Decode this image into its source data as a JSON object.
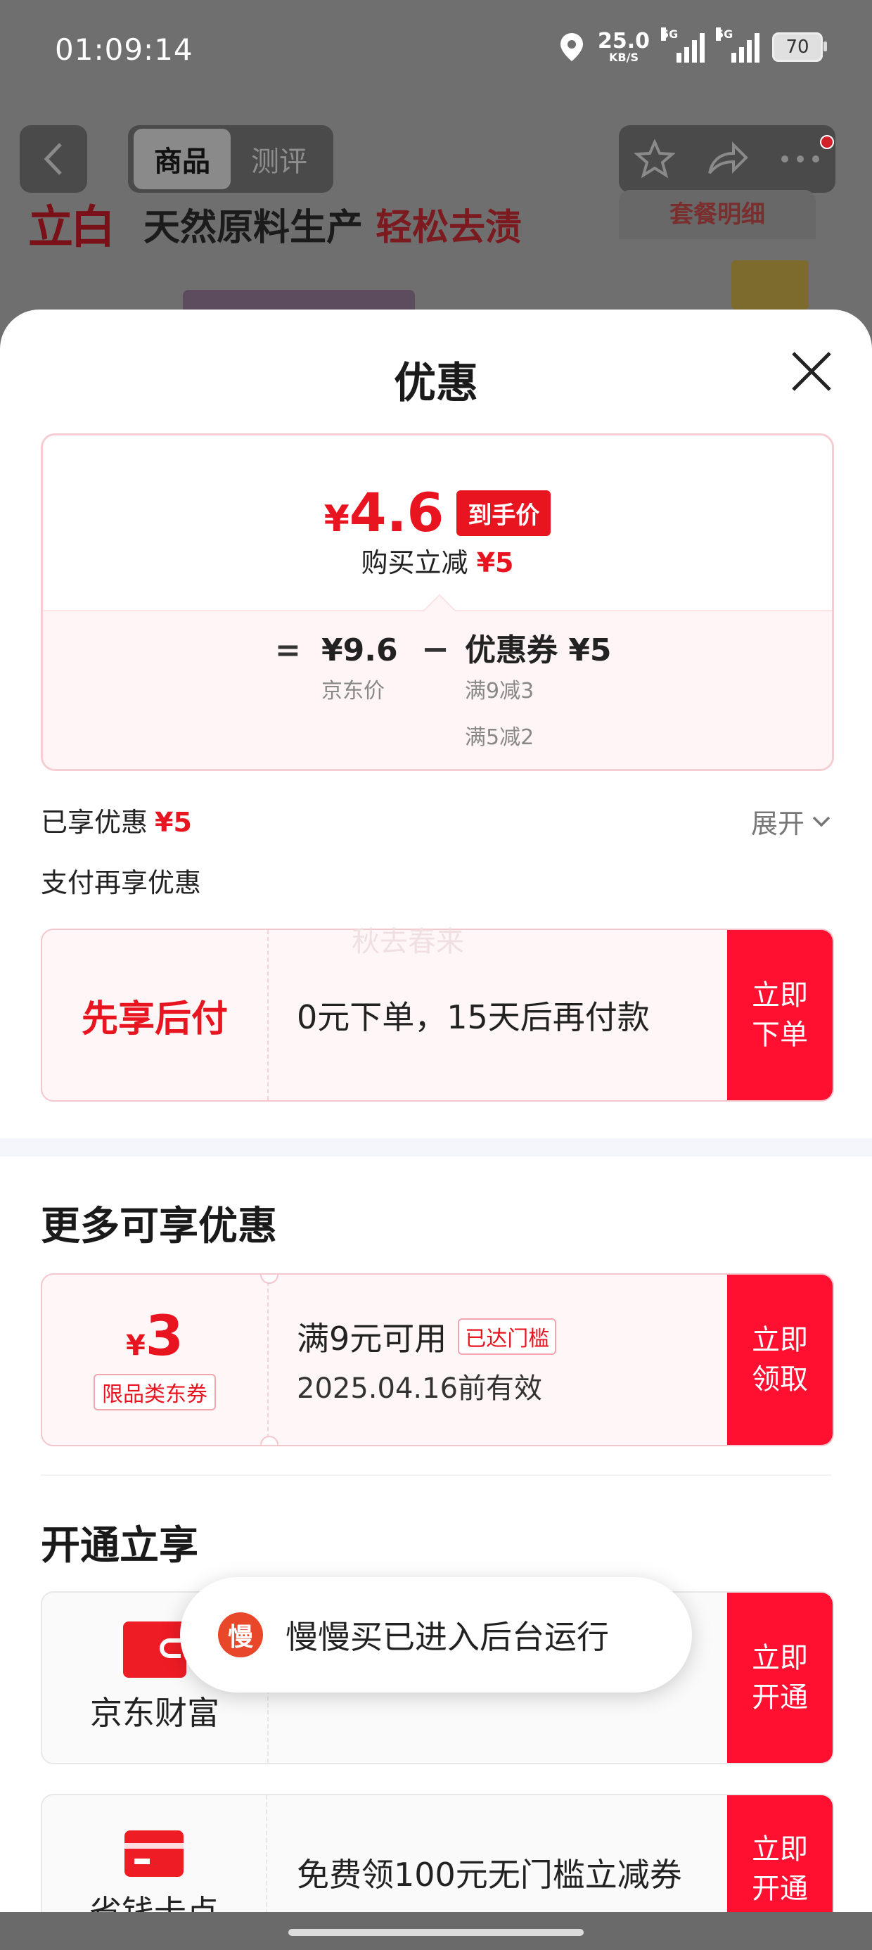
{
  "status_bar": {
    "time": "01:09:14",
    "net_speed": "25.0",
    "net_unit": "KB/S",
    "sig1": "5G",
    "sig2": "5G",
    "battery": "70"
  },
  "nav": {
    "tab_goods": "商品",
    "tab_review": "测评"
  },
  "bg": {
    "brand": "立白",
    "slogan_black": "天然原料生产",
    "slogan_red": "轻松去渍",
    "package_label": "套餐明细"
  },
  "sheet": {
    "title": "优惠",
    "price": {
      "symbol": "¥",
      "final": "4.6",
      "tag": "到手价",
      "sub_label": "购买立减",
      "sub_value": "¥5",
      "equals": "=",
      "jd_price": "¥9.6",
      "jd_label": "京东价",
      "minus": "−",
      "coupon": "优惠券 ¥5",
      "coupon_rule1": "满9减3",
      "coupon_rule2": "满5减2"
    },
    "enjoyed_label": "已享优惠",
    "enjoyed_value": "¥5",
    "expand_label": "展开",
    "pay_hint": "支付再享优惠",
    "bnpl": {
      "title": "先享后付",
      "desc": "0元下单，15天后再付款",
      "button": "立即下单",
      "watermark": "秋去春来"
    },
    "more_title": "更多可享优惠",
    "coupon": {
      "symbol": "¥",
      "amount": "3",
      "type": "限品类东券",
      "condition": "满9元可用",
      "badge": "已达门槛",
      "valid": "2025.04.16前有效",
      "button": "立即领取"
    },
    "open_title": "开通立享",
    "service1": {
      "name": "京东财富",
      "button": "立即开通"
    },
    "service2": {
      "name": "省钱卡点",
      "desc": "免费领100元无门槛立减券",
      "button": "立即开通"
    }
  },
  "toast": {
    "icon_char": "慢",
    "text": "慢慢买已进入后台运行"
  },
  "colors": {
    "accent": "#e8141f",
    "button_red": "#ff1030"
  }
}
